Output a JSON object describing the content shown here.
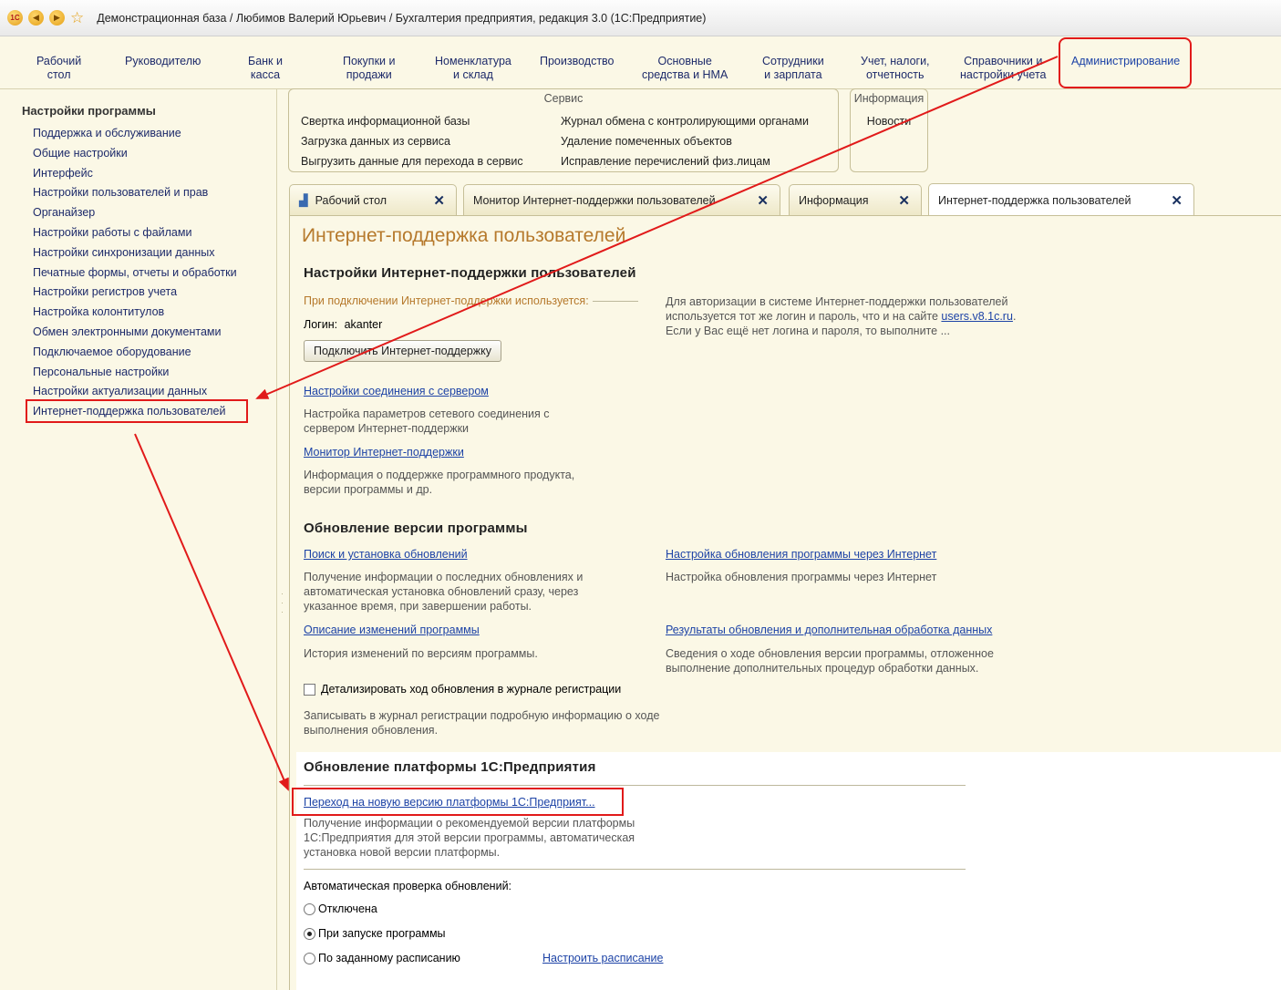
{
  "window": {
    "title": "Демонстрационная база / Любимов Валерий Юрьевич / Бухгалтерия предприятия, редакция 3.0  (1С:Предприятие)"
  },
  "sections": [
    {
      "l1": "Рабочий",
      "l2": "стол"
    },
    {
      "l1": "Руководителю",
      "l2": ""
    },
    {
      "l1": "Банк и",
      "l2": "касса"
    },
    {
      "l1": "Покупки и",
      "l2": "продажи"
    },
    {
      "l1": "Номенклатура",
      "l2": "и склад"
    },
    {
      "l1": "Производство",
      "l2": ""
    },
    {
      "l1": "Основные",
      "l2": "средства и НМА"
    },
    {
      "l1": "Сотрудники",
      "l2": "и зарплата"
    },
    {
      "l1": "Учет, налоги,",
      "l2": "отчетность"
    },
    {
      "l1": "Справочники и",
      "l2": "настройки учета"
    },
    {
      "l1": "Администрирование",
      "l2": ""
    }
  ],
  "leftnav": {
    "title": "Настройки программы",
    "items": [
      "Поддержка и обслуживание",
      "Общие настройки",
      "Интерфейс",
      "Настройки пользователей и прав",
      "Органайзер",
      "Настройки работы с файлами",
      "Настройки синхронизации данных",
      "Печатные формы, отчеты и обработки",
      "Настройки регистров учета",
      "Настройка колонтитулов",
      "Обмен электронными документами",
      "Подключаемое оборудование",
      "Персональные настройки",
      "Настройки актуализации данных",
      "Интернет-поддержка пользователей"
    ]
  },
  "service": {
    "title": "Сервис",
    "col1": [
      "Свертка информационной базы",
      "Загрузка данных из сервиса",
      "Выгрузить данные для перехода в сервис"
    ],
    "col2": [
      "Журнал обмена с контролирующими органами",
      "Удаление помеченных объектов",
      "Исправление перечислений физ.лицам"
    ]
  },
  "info": {
    "title": "Информация",
    "news": "Новости"
  },
  "tabs": [
    {
      "label": "Рабочий стол"
    },
    {
      "label": "Монитор Интернет-поддержки пользователей"
    },
    {
      "label": "Информация"
    },
    {
      "label": "Интернет-поддержка пользователей"
    }
  ],
  "content": {
    "title": "Интернет-поддержка пользователей",
    "settings_heading": "Настройки Интернет-поддержки пользователей",
    "using_label": "При подключении Интернет-поддержки используется:",
    "login_label": "Логин:",
    "login_value": "akanter",
    "connect_button": "Подключить Интернет-поддержку",
    "auth_hint_1": "Для авторизации в системе Интернет-поддержки пользователей используется тот же логин и пароль, что и на сайте",
    "auth_hint_site": "users.v8.1c.ru",
    "auth_hint_2": "Если у Вас ещё нет логина и пароля, то выполните ...",
    "server_link": "Настройки соединения с сервером",
    "server_desc": "Настройка параметров сетевого соединения с сервером Интернет-поддержки",
    "monitor_link": "Монитор Интернет-поддержки",
    "monitor_desc": "Информация о поддержке программного продукта, версии программы и др.",
    "update_heading": "Обновление версии программы",
    "search_link": "Поиск и установка обновлений",
    "search_desc": "Получение информации о последних обновлениях и автоматическая установка обновлений сразу, через указанное время, при завершении работы.",
    "setup_link": "Настройка обновления программы через Интернет",
    "setup_desc": "Настройка обновления программы через Интернет",
    "changes_link": "Описание изменений программы",
    "changes_desc": "История изменений по версиям программы.",
    "results_link": "Результаты обновления и дополнительная обработка данных",
    "results_desc": "Сведения о ходе обновления версии программы, отложенное выполнение дополнительных процедур обработки данных.",
    "detail_checkbox": "Детализировать ход обновления в журнале регистрации",
    "detail_desc": "Записывать в журнал регистрации подробную информацию о ходе выполнения обновления.",
    "platform_heading": "Обновление платформы 1С:Предприятия",
    "platform_link": "Переход на новую версию платформы 1С:Предприят...",
    "platform_desc": "Получение информации о рекомендуемой версии платформы 1С:Предприятия для этой версии программы, автоматическая установка новой версии платформы.",
    "auto_check_label": "Автоматическая проверка обновлений:",
    "radio_off": "Отключена",
    "radio_startup": "При запуске программы",
    "radio_schedule": "По заданному расписанию",
    "schedule_link": "Настроить расписание"
  },
  "colors": {
    "annotation": "#e11a1a",
    "heading_accent": "#b6792c",
    "link": "#1d43a6"
  }
}
